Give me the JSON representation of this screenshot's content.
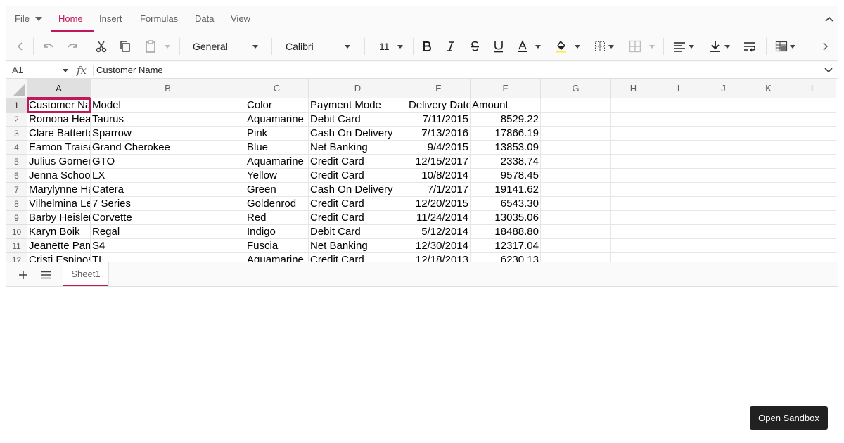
{
  "ribbon": {
    "tabs": [
      "File",
      "Home",
      "Insert",
      "Formulas",
      "Data",
      "View"
    ],
    "active_tab": "Home"
  },
  "toolbar": {
    "number_format": "General",
    "font_family": "Calibri",
    "font_size": "11"
  },
  "formula_bar": {
    "name_box": "A1",
    "fx_label": "fx",
    "value": "Customer Name"
  },
  "sheet": {
    "columns": [
      "A",
      "B",
      "C",
      "D",
      "E",
      "F",
      "G",
      "H",
      "I",
      "J",
      "K",
      "L"
    ],
    "row_numbers": [
      "1",
      "2",
      "3",
      "4",
      "5",
      "6",
      "7",
      "8",
      "9",
      "10",
      "11",
      "12"
    ],
    "rows": [
      [
        "Customer Name",
        "Model",
        "Color",
        "Payment Mode",
        "Delivery Date",
        "Amount"
      ],
      [
        "Romona Heaslip",
        "Taurus",
        "Aquamarine",
        "Debit Card",
        "7/11/2015",
        "8529.22"
      ],
      [
        "Clare Batterton",
        "Sparrow",
        "Pink",
        "Cash On Delivery",
        "7/13/2016",
        "17866.19"
      ],
      [
        "Eamon Traise",
        "Grand Cherokee",
        "Blue",
        "Net Banking",
        "9/4/2015",
        "13853.09"
      ],
      [
        "Julius Gorner",
        "GTO",
        "Aquamarine",
        "Credit Card",
        "12/15/2017",
        "2338.74"
      ],
      [
        "Jenna Schoolfield",
        "LX",
        "Yellow",
        "Credit Card",
        "10/8/2014",
        "9578.45"
      ],
      [
        "Marylynne Harring",
        "Catera",
        "Green",
        "Cash On Delivery",
        "7/1/2017",
        "19141.62"
      ],
      [
        "Vilhelmina Leipelt",
        "7 Series",
        "Goldenrod",
        "Credit Card",
        "12/20/2015",
        "6543.30"
      ],
      [
        "Barby Heisler",
        "Corvette",
        "Red",
        "Credit Card",
        "11/24/2014",
        "13035.06"
      ],
      [
        "Karyn Boik",
        "Regal",
        "Indigo",
        "Debit Card",
        "5/12/2014",
        "18488.80"
      ],
      [
        "Jeanette Pamplin",
        "S4",
        "Fuscia",
        "Net Banking",
        "12/30/2014",
        "12317.04"
      ],
      [
        "Cristi Espinos",
        "TL",
        "Aquamarine",
        "Credit Card",
        "12/18/2013",
        "6230.13"
      ]
    ],
    "selected_cell": "A1"
  },
  "sheet_tabs": [
    "Sheet1"
  ],
  "open_sandbox_label": "Open Sandbox",
  "colors": {
    "accent": "#c2185b",
    "fill_color_swatch": "#ffeb3b"
  }
}
